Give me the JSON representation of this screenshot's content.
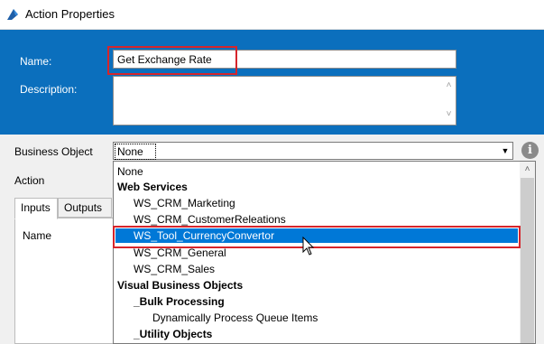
{
  "window": {
    "title": "Action Properties",
    "app_icon": "blue-prism-icon"
  },
  "header": {
    "name_label": "Name:",
    "name_value": "Get Exchange Rate",
    "description_label": "Description:",
    "description_value": ""
  },
  "business_object": {
    "label": "Business Object",
    "selected": "None",
    "info_icon": "info-icon"
  },
  "action": {
    "label": "Action"
  },
  "tabs": [
    {
      "label": "Inputs",
      "active": true
    },
    {
      "label": "Outputs",
      "active": false
    }
  ],
  "table": {
    "column_name": "Name"
  },
  "dropdown": {
    "items": [
      {
        "label": "None",
        "bold": false,
        "level": 0
      },
      {
        "label": "Web Services",
        "bold": true,
        "level": 0
      },
      {
        "label": "WS_CRM_Marketing",
        "bold": false,
        "level": 1
      },
      {
        "label": "WS_CRM_CustomerReleations",
        "bold": false,
        "level": 1
      },
      {
        "label": "WS_Tool_CurrencyConvertor",
        "bold": false,
        "level": 1,
        "selected": true
      },
      {
        "label": "WS_CRM_General",
        "bold": false,
        "level": 1
      },
      {
        "label": "WS_CRM_Sales",
        "bold": false,
        "level": 1
      },
      {
        "label": "Visual Business Objects",
        "bold": true,
        "level": 0
      },
      {
        "label": "_Bulk Processing",
        "bold": true,
        "level": 1
      },
      {
        "label": "Dynamically Process Queue Items",
        "bold": false,
        "level": 2
      },
      {
        "label": "_Utility Objects",
        "bold": true,
        "level": 1
      }
    ]
  },
  "colors": {
    "header_blue": "#0b6fbd",
    "selection_blue": "#0078d7",
    "highlight_red": "#d6252b"
  }
}
